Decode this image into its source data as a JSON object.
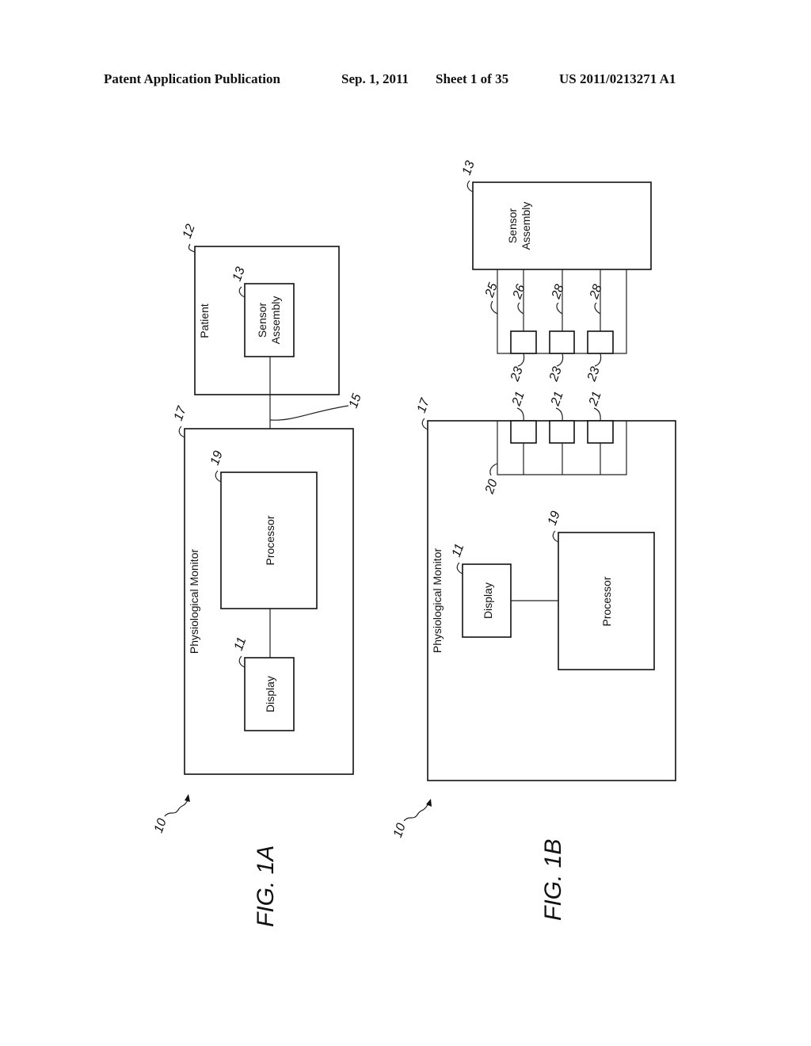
{
  "header": {
    "publication": "Patent Application Publication",
    "date": "Sep. 1, 2011",
    "sheet": "Sheet 1 of 35",
    "number": "US 2011/0213271 A1"
  },
  "fig1a": {
    "caption": "FIG. 1A",
    "system_ref": "10",
    "patient": {
      "label": "Patient",
      "ref": "12"
    },
    "sensor": {
      "label_line1": "Sensor",
      "label_line2": "Assembly",
      "ref": "13"
    },
    "cable_ref": "15",
    "monitor": {
      "label": "Physiological Monitor",
      "ref": "17"
    },
    "processor": {
      "label": "Processor",
      "ref": "19"
    },
    "display": {
      "label": "Display",
      "ref": "11"
    }
  },
  "fig1b": {
    "caption": "FIG. 1B",
    "system_ref": "10",
    "sensor": {
      "label_line1": "Sensor",
      "label_line2": "Assembly",
      "ref": "13"
    },
    "sensor_connector_ref": "25",
    "sensor_lines": [
      "26",
      "28",
      "28"
    ],
    "sensor_contacts": [
      "23",
      "23",
      "23"
    ],
    "monitor_contacts": [
      "21",
      "21",
      "21"
    ],
    "monitor_connector_ref": "20",
    "monitor": {
      "label": "Physiological Monitor",
      "ref": "17"
    },
    "display": {
      "label": "Display",
      "ref": "11"
    },
    "processor": {
      "label": "Processor",
      "ref": "19"
    }
  }
}
